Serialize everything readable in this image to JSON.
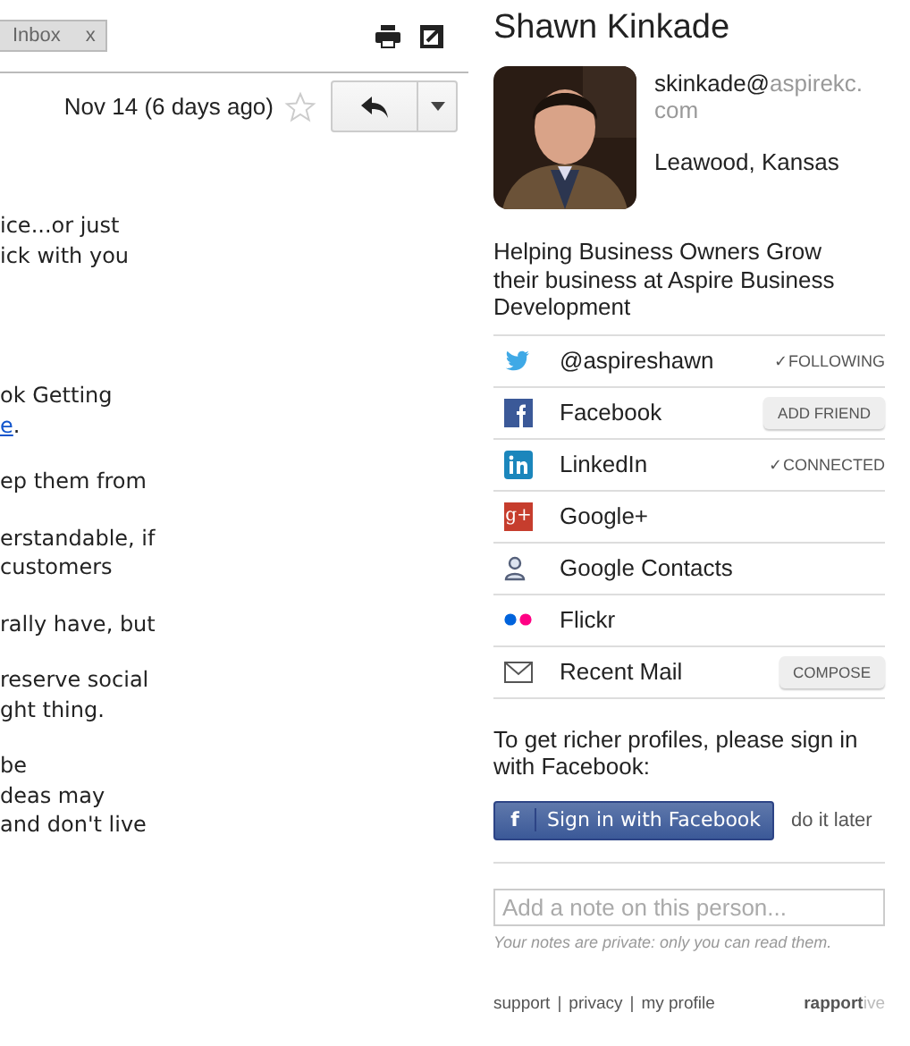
{
  "mail": {
    "label": {
      "text": "Inbox",
      "close": "x"
    },
    "date": "Nov 14 (6 days ago)",
    "starred": false,
    "body": [
      {
        "lines": [
          {
            "text": "ice...or just"
          },
          {
            "text": "ick with you"
          }
        ]
      },
      {
        "lines": [
          {
            "text": "ok Getting"
          },
          {
            "link": "e",
            "text": "."
          }
        ]
      },
      {
        "lines": [
          {
            "text": "ep them from"
          }
        ]
      },
      {
        "lines": [
          {
            "text": "erstandable, if"
          },
          {
            "text": "customers"
          }
        ]
      },
      {
        "lines": [
          {
            "text": "rally have, but"
          }
        ]
      },
      {
        "lines": [
          {
            "text": "reserve social"
          },
          {
            "text": "ght thing."
          }
        ]
      },
      {
        "lines": [
          {
            "text": "be"
          },
          {
            "text": "deas may"
          },
          {
            "text": "and don't live"
          }
        ]
      }
    ]
  },
  "profile": {
    "name": "Shawn Kinkade",
    "email_user": "skinkade@",
    "email_domain": "aspirekc.\ncom",
    "location": "Leawood, Kansas",
    "bio": "Helping Business Owners Grow their business at Aspire Business Development",
    "networks": [
      {
        "kind": "twitter",
        "label": "@aspireshawn",
        "status": "✓FOLLOWING"
      },
      {
        "kind": "facebook",
        "label": "Facebook",
        "action": "ADD FRIEND"
      },
      {
        "kind": "linkedin",
        "label": "LinkedIn",
        "status": "✓CONNECTED"
      },
      {
        "kind": "googleplus",
        "label": "Google+",
        "icon_text": "g+"
      },
      {
        "kind": "contacts",
        "label": "Google Contacts"
      },
      {
        "kind": "flickr",
        "label": "Flickr"
      },
      {
        "kind": "mail",
        "label": "Recent Mail",
        "action": "COMPOSE"
      }
    ],
    "signin_prompt": "To get richer profiles, please sign in with Facebook:",
    "signin_button": {
      "icon": "f",
      "label": "Sign in with Facebook"
    },
    "later": "do it later",
    "note_placeholder": "Add a note on this person...",
    "note_hint": "Your notes are private: only you can read them.",
    "footer_links": [
      "support",
      "privacy",
      "my profile"
    ],
    "footer_separator": "|",
    "brand": {
      "bold": "rapport",
      "light": "ive"
    }
  }
}
